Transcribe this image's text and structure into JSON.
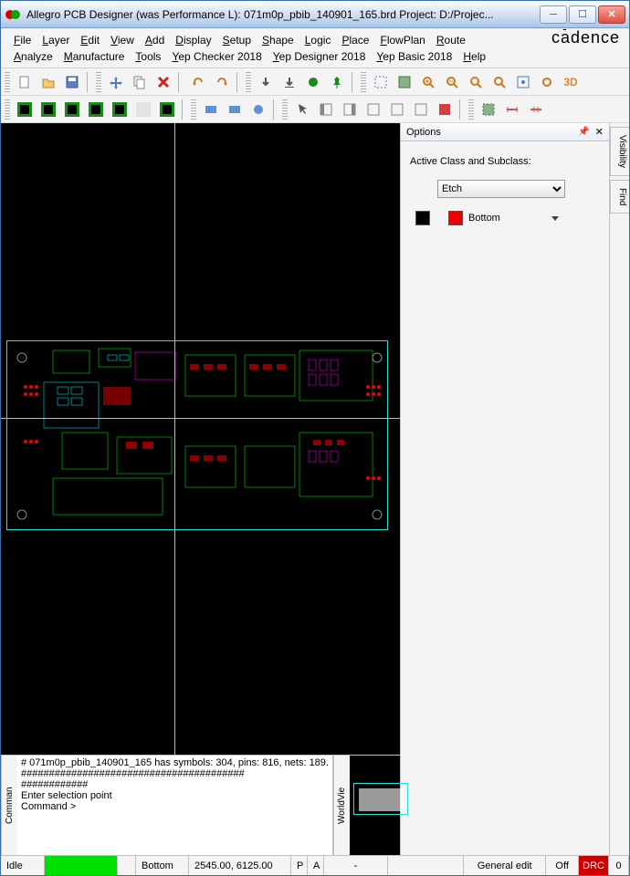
{
  "titlebar": {
    "title": "Allegro PCB Designer (was Performance L): 071m0p_pbib_140901_165.brd  Project: D:/Projec..."
  },
  "menu": {
    "items_row1": [
      "File",
      "Layer",
      "Edit",
      "View",
      "Add",
      "Display",
      "Setup",
      "Shape",
      "Logic",
      "Place",
      "FlowPlan",
      "Route",
      "Analyze"
    ],
    "items_row2": [
      "Manufacture",
      "Tools",
      "Yep Checker 2018",
      "Yep Designer 2018",
      "Yep Basic 2018",
      "Help"
    ],
    "brand": "cādence"
  },
  "toolbar": {
    "row1": [
      "new",
      "open",
      "save",
      "sep",
      "move",
      "copy",
      "delete",
      "undo",
      "redo",
      "sep",
      "align-l",
      "align-c",
      "align-r",
      "sep",
      "marker",
      "pin",
      "sep",
      "zoom-window",
      "zoom-fit",
      "zoom-in",
      "zoom-out",
      "zoom-sel",
      "zoom-prev",
      "zoom-obj",
      "refresh",
      "3d"
    ],
    "row2": [
      "layer-g1",
      "layer-g2",
      "layer-g3",
      "layer-g4",
      "layer-g5",
      "layer-empty",
      "layer-g6",
      "sep",
      "rect",
      "rect2",
      "circle",
      "sep",
      "arrow",
      "panel1",
      "panel2",
      "panel3",
      "panel4",
      "panel5",
      "warn",
      "sep",
      "measure",
      "dim-h",
      "dim-v"
    ]
  },
  "options": {
    "title": "Options",
    "label_class": "Active Class and Subclass:",
    "select_value": "Etch",
    "subclass_label": "Bottom"
  },
  "side_tabs": [
    "Visibility",
    "Find"
  ],
  "command_panel": {
    "tab": "Comman",
    "lines": [
      "#  071m0p_pbib_140901_165 has symbols: 304, pins: 816, nets: 189.",
      "########################################",
      "############",
      "Enter selection point",
      "Command >"
    ]
  },
  "world_panel": {
    "tab": "WorldVie"
  },
  "status": {
    "idle": "Idle",
    "layer": "Bottom",
    "coords": "2545.00, 6125.00",
    "p": "P",
    "a": "A",
    "dash": "-",
    "mode": "General edit",
    "off": "Off",
    "drc": "DRC",
    "zero": "0"
  }
}
